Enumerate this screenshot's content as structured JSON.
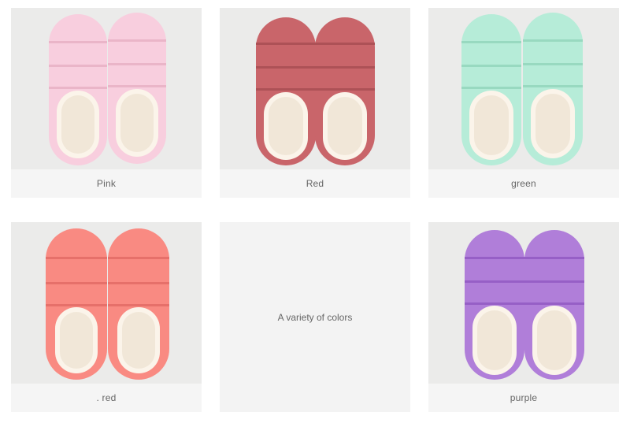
{
  "grid": {
    "items": [
      {
        "label": "Pink",
        "color": "#f8cede",
        "accent": "#f0b7cc",
        "image": "pink-slippers"
      },
      {
        "label": "Red",
        "color": "#c9656a",
        "accent": "#b3565b",
        "image": "red-slippers"
      },
      {
        "label": "green",
        "color": "#b6ecd8",
        "accent": "#9fe0c7",
        "image": "green-slippers"
      },
      {
        "label": ". red",
        "color": "#f98a82",
        "accent": "#ee7068",
        "image": "coral-slippers"
      },
      {
        "label": "A variety of colors"
      },
      {
        "label": "purple",
        "color": "#b07ed9",
        "accent": "#9a63c9",
        "image": "purple-slippers"
      }
    ]
  }
}
